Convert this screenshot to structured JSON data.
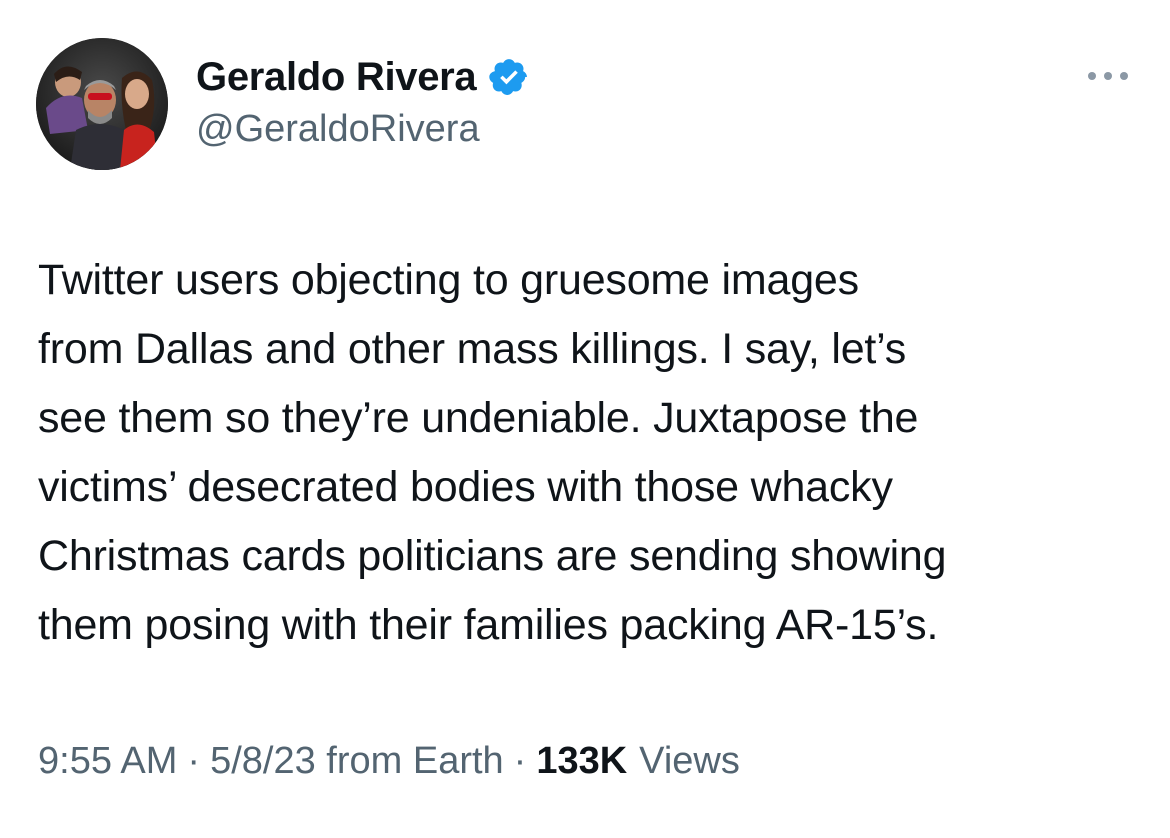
{
  "author": {
    "display_name": "Geraldo Rivera",
    "handle": "@GeraldoRivera",
    "verified": true,
    "verified_icon": "verified-badge-icon",
    "avatar_icon": "profile-photo",
    "badge_color": "#1d9bf0"
  },
  "tweet": {
    "text": "Twitter users objecting to gruesome images\nfrom Dallas and other mass killings. I say, let’s\nsee them so they’re undeniable. Juxtapose the\nvictims’ desecrated bodies with those whacky\nChristmas cards politicians are sending showing\nthem posing with their families packing AR-15’s."
  },
  "meta": {
    "time": "9:55 AM",
    "separator": "·",
    "date_source": "5/8/23 from Earth",
    "views_count": "133K",
    "views_label": "Views"
  },
  "actions": {
    "more_icon": "more-options-icon"
  },
  "colors": {
    "text_primary": "#0f1419",
    "text_secondary": "#536471",
    "accent": "#1d9bf0"
  }
}
